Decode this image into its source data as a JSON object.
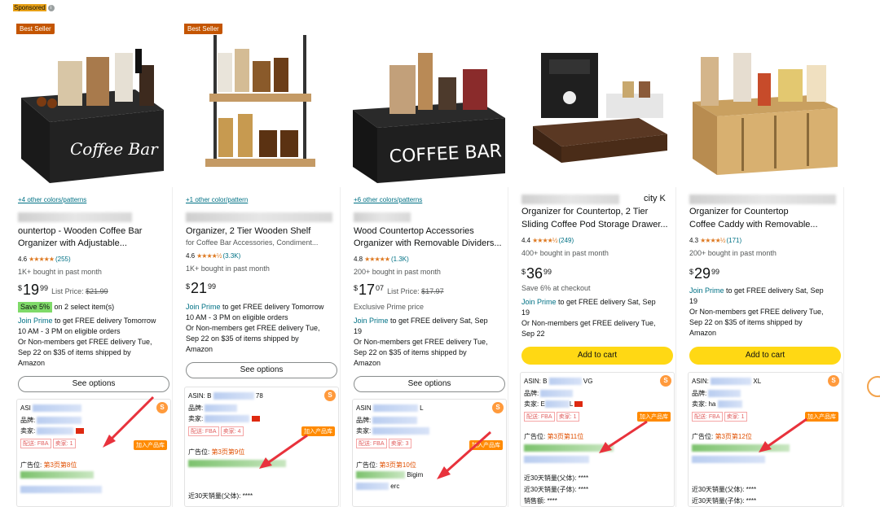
{
  "sponsored": {
    "label": "Sponsored",
    "info": "i"
  },
  "colors": {
    "accent": "#ffd814",
    "link": "#007185",
    "badge": "#c45500",
    "arrow": "#e8323c"
  },
  "products": [
    {
      "badge": "Best Seller",
      "swatch": "+4 other colors/patterns",
      "title1": "ountertop - Wooden Coffee Bar",
      "title2": "Organizer with Adjustable...",
      "subtitle": "",
      "rating": "4.6",
      "stars": "★★★★★",
      "count": "(255)",
      "bought": "1K+ bought in past month",
      "price_sym": "$",
      "price_whole": "19",
      "price_frac": "99",
      "list_label": "List Price:",
      "list_price": "$21.99",
      "save_badge": "Save 5%",
      "save_text": "on 2 select item(s)",
      "delivery_lines": [
        "Join Prime to get FREE delivery Tomorrow",
        "10 AM - 3 PM on eligible orders",
        "Or Non-members get FREE delivery Tue,",
        "Sep 22 on $35 of items shipped by",
        "Amazon"
      ],
      "button": "See options",
      "ext": {
        "asin": "ASI",
        "brand": "品牌:",
        "seller": "卖家:",
        "ship": "配送: FBA",
        "sellers": "卖家: 1",
        "add": "加入产品库",
        "ad_label": "广告位:",
        "ad_pos": "第3页第8位",
        "sales_parent": "",
        "sales_child": ""
      }
    },
    {
      "badge": "Best Seller",
      "swatch": "+1 other color/pattern",
      "title1": "Organizer, 2 Tier Wooden Shelf",
      "title2": "",
      "subtitle": "for Coffee Bar Accessories, Condiment...",
      "rating": "4.6",
      "stars": "★★★★½",
      "count": "(3.3K)",
      "bought": "1K+ bought in past month",
      "price_sym": "$",
      "price_whole": "21",
      "price_frac": "99",
      "delivery_lines": [
        "Join Prime to get FREE delivery Tomorrow",
        "10 AM - 3 PM on eligible orders",
        "Or Non-members get FREE delivery Tue,",
        "Sep 22 on $35 of items shipped by",
        "Amazon"
      ],
      "button": "See options",
      "ext": {
        "asin": "ASIN: B",
        "asin_tail": "78",
        "brand": "品牌:",
        "seller": "卖家:",
        "ship": "配送: FBA",
        "sellers": "卖家: 4",
        "add": "加入产品库",
        "ad_label": "广告位:",
        "ad_pos": "第3页第9位",
        "sales_parent": "近30天销量(父体): ****"
      }
    },
    {
      "badge": "",
      "swatch": "+6 other colors/patterns",
      "title1": "Wood Countertop Accessories",
      "title2": "Organizer with Removable Dividers...",
      "subtitle": "",
      "rating": "4.8",
      "stars": "★★★★★",
      "count": "(1.3K)",
      "bought": "200+ bought in past month",
      "price_sym": "$",
      "price_whole": "17",
      "price_frac": "07",
      "list_label": "List Price:",
      "list_price": "$17.97",
      "exclusive": "Exclusive Prime price",
      "delivery_lines": [
        "Join Prime to get FREE delivery Sat, Sep",
        "19",
        "Or Non-members get FREE delivery Tue,",
        "Sep 22 on $35 of items shipped by",
        "Amazon"
      ],
      "button": "See options",
      "ext": {
        "asin": "ASIN",
        "asin_tail": "L",
        "brand": "品牌:",
        "seller": "卖家:",
        "ship": "配送: FBA",
        "sellers": "卖家: 3",
        "add": "加入产品库",
        "ad_label": "广告位:",
        "ad_pos": "第3页第10位",
        "extra": "Bigim",
        "extra2": "erc"
      }
    },
    {
      "badge": "",
      "swatch": "",
      "title1": "city K",
      "title2": "Organizer for Countertop, 2 Tier",
      "title3": "Sliding Coffee Pod Storage Drawer...",
      "subtitle": "",
      "rating": "4.4",
      "stars": "★★★★½",
      "count": "(249)",
      "bought": "400+ bought in past month",
      "price_sym": "$",
      "price_whole": "36",
      "price_frac": "99",
      "save_text": "Save 6% at checkout",
      "delivery_lines": [
        "Join Prime to get FREE delivery Sat, Sep",
        "19",
        "Or Non-members get FREE delivery Tue,",
        "Sep 22"
      ],
      "button": "Add to cart",
      "ext": {
        "asin": "ASIN: B",
        "asin_tail": "VG",
        "brand": "品牌:",
        "seller": "卖家:",
        "seller_tail": "E",
        "seller_tail2": "L",
        "ship": "配送: FBA",
        "sellers": "卖家: 1",
        "add": "加入产品库",
        "ad_label": "广告位:",
        "ad_pos": "第3页第11位",
        "sales_parent": "近30天销量(父体): ****",
        "sales_child": "近30天销量(子体): ****",
        "sales_total": "销售额: ****"
      }
    },
    {
      "badge": "",
      "swatch": "",
      "title1": "Organizer for Countertop",
      "title2": "Coffee Caddy with Removable...",
      "subtitle": "",
      "rating": "4.3",
      "stars": "★★★★½",
      "count": "(171)",
      "bought": "200+ bought in past month",
      "price_sym": "$",
      "price_whole": "29",
      "price_frac": "99",
      "delivery_lines": [
        "Join Prime to get FREE delivery Sat, Sep",
        "19",
        "Or Non-members get FREE delivery Tue,",
        "Sep 22 on $35 of items shipped by",
        "Amazon"
      ],
      "button": "Add to cart",
      "ext": {
        "asin": "ASIN:",
        "asin_tail": "XL",
        "brand": "品牌:",
        "seller": "卖家: ha",
        "ship": "配送: FBA",
        "sellers": "卖家: 1",
        "add": "加入产品库",
        "ad_label": "广告位:",
        "ad_pos": "第3页第12位",
        "sales_parent": "近30天销量(父体): ****",
        "sales_child": "近30天销量(子体): ****"
      }
    }
  ]
}
